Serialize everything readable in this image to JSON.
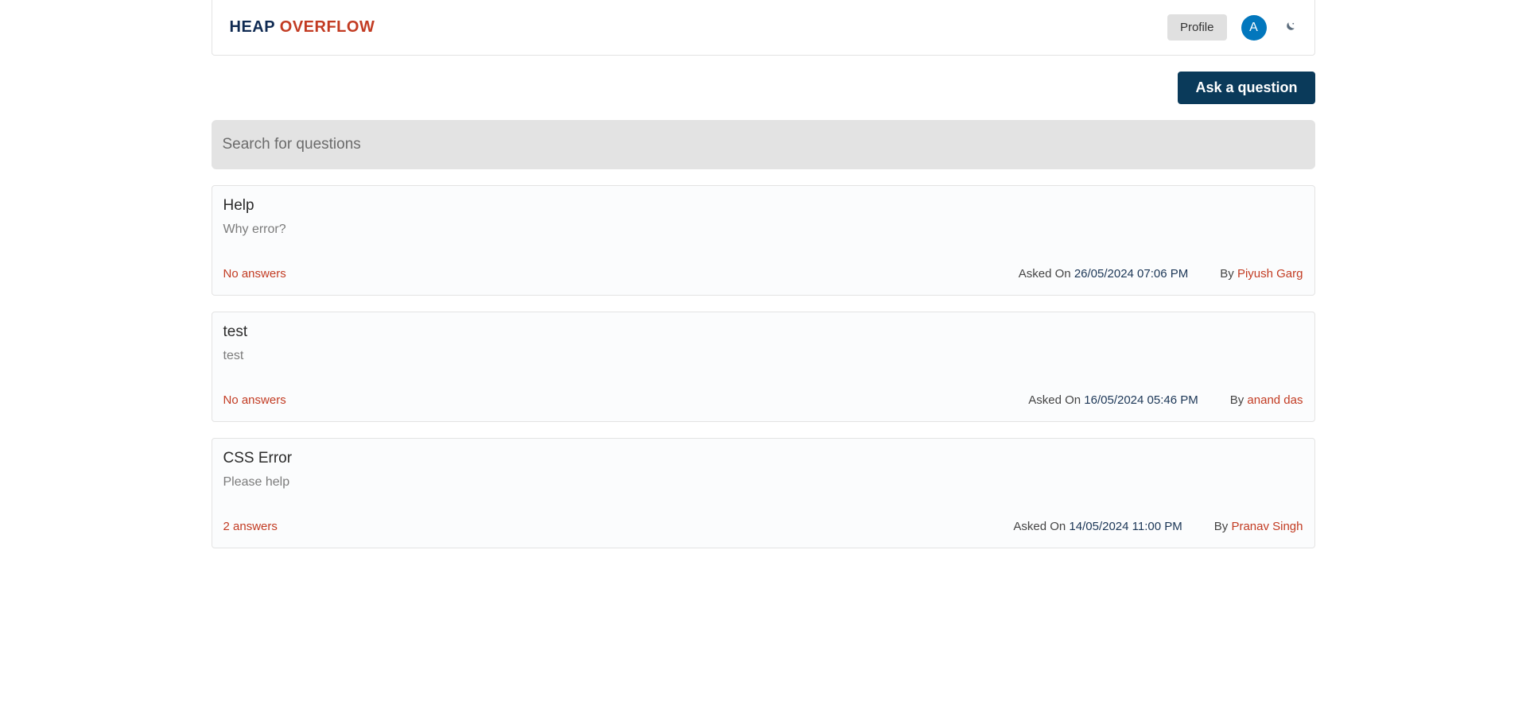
{
  "header": {
    "logo_heap": "HEAP",
    "logo_overflow": "OVERFLOW",
    "profile_label": "Profile",
    "avatar_initial": "A"
  },
  "actions": {
    "ask_label": "Ask a question"
  },
  "search": {
    "placeholder": "Search for questions"
  },
  "labels": {
    "asked_on": "Asked On",
    "by": "By"
  },
  "questions": [
    {
      "title": "Help",
      "body": "Why error?",
      "answers": "No answers",
      "date": "26/05/2024 07:06 PM",
      "author": "Piyush Garg"
    },
    {
      "title": "test",
      "body": "test",
      "answers": "No answers",
      "date": "16/05/2024 05:46 PM",
      "author": "anand das"
    },
    {
      "title": "CSS Error",
      "body": "Please help",
      "answers": "2 answers",
      "date": "14/05/2024 11:00 PM",
      "author": "Pranav Singh"
    }
  ]
}
